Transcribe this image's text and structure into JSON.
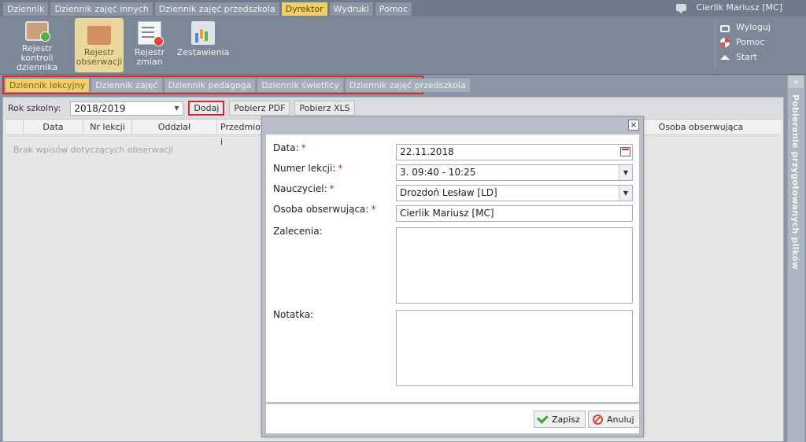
{
  "top_menu": {
    "items": [
      "Dziennik",
      "Dziennik zajęć innych",
      "Dziennik zajęć przedszkola",
      "Dyrektor",
      "Wydruki",
      "Pomoc"
    ],
    "active": "Dyrektor",
    "user": "Cierlik Mariusz [MC]"
  },
  "ribbon": {
    "buttons": [
      {
        "label": "Rejestr kontroli dziennika",
        "icon": "book-check-icon"
      },
      {
        "label": "Rejestr obserwacji",
        "icon": "folder-calendar-icon",
        "active": true
      },
      {
        "label": "Rejestr zmian",
        "icon": "list-edit-icon"
      },
      {
        "label": "Zestawienia",
        "icon": "chart-icon"
      }
    ],
    "right_links": [
      {
        "label": "Wyloguj",
        "icon": "lock-icon"
      },
      {
        "label": "Pomoc",
        "icon": "lifebuoy-icon"
      },
      {
        "label": "Start",
        "icon": "home-icon"
      }
    ]
  },
  "subtabs": {
    "items": [
      "Dziennik lekcyjny",
      "Dziennik zajęć",
      "Dziennik pedagoga",
      "Dziennik świetlicy",
      "Dziennik zajęć przedszkola"
    ],
    "active": "Dziennik lekcyjny"
  },
  "toolbar": {
    "school_year_label": "Rok szkolny:",
    "school_year_value": "2018/2019",
    "add_label": "Dodaj",
    "pdf_label": "Pobierz PDF",
    "xls_label": "Pobierz XLS"
  },
  "table": {
    "columns": [
      "Data",
      "Nr lekcji",
      "Oddział",
      "Przedmiot i",
      "Osoba obserwująca"
    ],
    "empty_message": "Brak wpisów dotyczących obserwacji"
  },
  "side_panel": {
    "title": "Pobieranie przygotowanych plików"
  },
  "dialog": {
    "close_label": "×",
    "fields": {
      "date_label": "Data:",
      "date_value": "22.11.2018",
      "lesson_label": "Numer lekcji:",
      "lesson_value": "3. 09:40 - 10:25",
      "teacher_label": "Nauczyciel:",
      "teacher_value": "Drozdoń Lesław [LD]",
      "observer_label": "Osoba obserwująca:",
      "observer_value": "Cierlik Mariusz [MC]",
      "recommendations_label": "Zalecenia:",
      "note_label": "Notatka:"
    },
    "required_mark": "*",
    "save_label": "Zapisz",
    "cancel_label": "Anuluj"
  },
  "colors": {
    "accent_tab": "#f2cf6a",
    "highlight_border": "#d42a2a",
    "toolbar_bg": "#7c8797"
  }
}
